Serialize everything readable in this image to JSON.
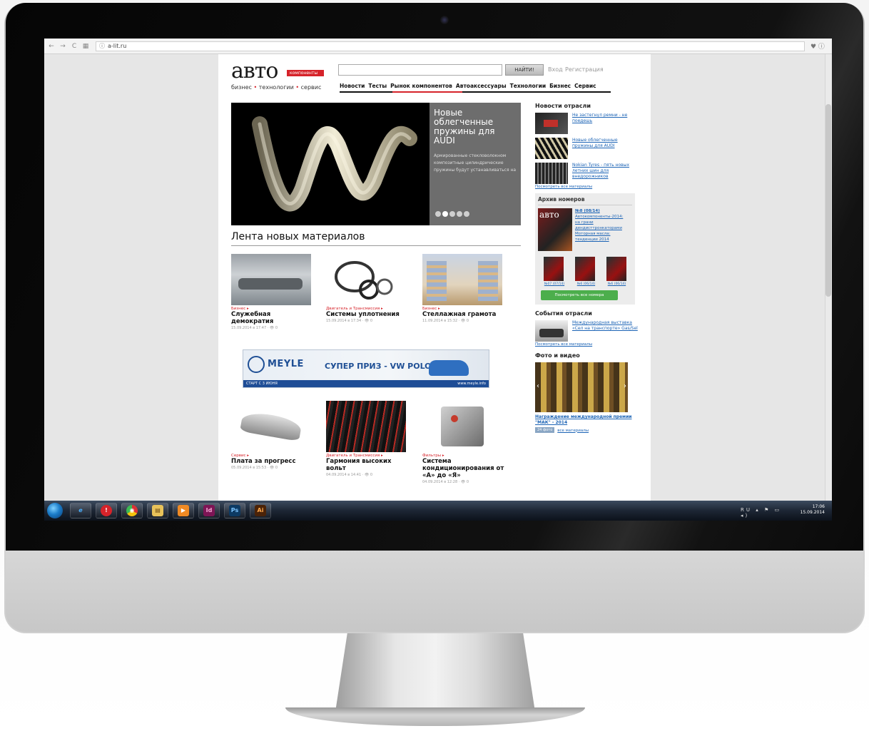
{
  "browser": {
    "url": "a-lit.ru",
    "back_icon": "←",
    "forward_icon": "→",
    "reload_icon": "C",
    "apps_icon": "▦",
    "site_icon": "ⓘ",
    "ext_icons": "♥ ⓘ"
  },
  "header": {
    "logo_main": "авто",
    "logo_tag": "компоненты",
    "logo_sub_1": "бизнес",
    "logo_sub_2": "технологии",
    "logo_sub_3": "сервис",
    "search_button": "НАЙТИ!",
    "login": "Вход",
    "register": "Регистрация",
    "nav": [
      "Новости",
      "Тесты",
      "Рынок компонентов",
      "Автоаксессуары",
      "Технологии",
      "Бизнес",
      "Сервис"
    ]
  },
  "hero": {
    "title": "Новые облегченные пружины для AUDI",
    "description": "Армированные стекловолокном композитные цилиндрические пружины будут устанавливаться на"
  },
  "feed": {
    "title": "Лента новых материалов",
    "cards": [
      {
        "category": "Бизнес ▸",
        "title": "Служебная демократия",
        "meta": "15.09.2014 в 17:47 · 👁 0"
      },
      {
        "category": "Двигатель и Трансмиссия ▸",
        "title": "Системы уплотнения",
        "meta": "15.09.2014 в 17:34 · 👁 0"
      },
      {
        "category": "Бизнес ▸",
        "title": "Стеллажная грамота",
        "meta": "11.09.2014 в 15:32 · 👁 0"
      },
      {
        "category": "Сервис ▸",
        "title": "Плата за прогресс",
        "meta": "05.09.2014 в 15:53 · 👁 0"
      },
      {
        "category": "Двигатель и Трансмиссия ▸",
        "title": "Гармония высоких вольт",
        "meta": "04.09.2014 в 14:41 · 👁 0"
      },
      {
        "category": "Фильтры ▸",
        "title": "Система кондиционирования от «А» до «Я»",
        "meta": "04.09.2014 в 12:28 · 👁 0"
      }
    ]
  },
  "banner": {
    "brand": "MEYLE",
    "text": "СУПЕР ПРИЗ - VW POLO",
    "footer_left": "СТАРТ С 3 ИЮНЯ",
    "footer_right": "www.meyle.info"
  },
  "sidebar": {
    "industry_news_title": "Новости отрасли",
    "industry_news": [
      "Не застегнул ремни - не поедешь",
      "Новые облегченные пружины для AUDI",
      "Nokian Tyres - пять новых летних шин для внедорожников"
    ],
    "all_materials": "Посмотреть все материалы",
    "archive_title": "Архив номеров",
    "archive_issue": "№8 (08/14)",
    "archive_lines": [
      "Автокомпоненты-2014:",
      "на грани",
      "дендисттронкаторами",
      "Моторная масла:",
      "тенденции 2014"
    ],
    "archive_minis": [
      "№07 (07/14)",
      "№6 (06/14)",
      "№6 (06/14)"
    ],
    "archive_button": "Посмотреть все номера",
    "events_title": "События отрасли",
    "event": "Международная выставка «Сел на транспорте» Gas/Sel",
    "events_all": "Посмотреть все материалы",
    "photo_title": "Фото и видео",
    "photo_caption": "Награждение международной премии \"МАК\" - 2014",
    "photo_all": "все материалы",
    "photo_badge": "24 фото"
  },
  "taskbar": {
    "time": "17:06",
    "date": "15.09.2014",
    "tray": "RU ▴ ⚑ ▭ ◂)",
    "app_labels": [
      "e",
      "!",
      "◉",
      "▤",
      "▶",
      "Id",
      "Ps",
      "Ai"
    ]
  },
  "colors": {
    "accent_red": "#d6232a",
    "link_blue": "#1b63b5",
    "button_green": "#4cae4c"
  }
}
